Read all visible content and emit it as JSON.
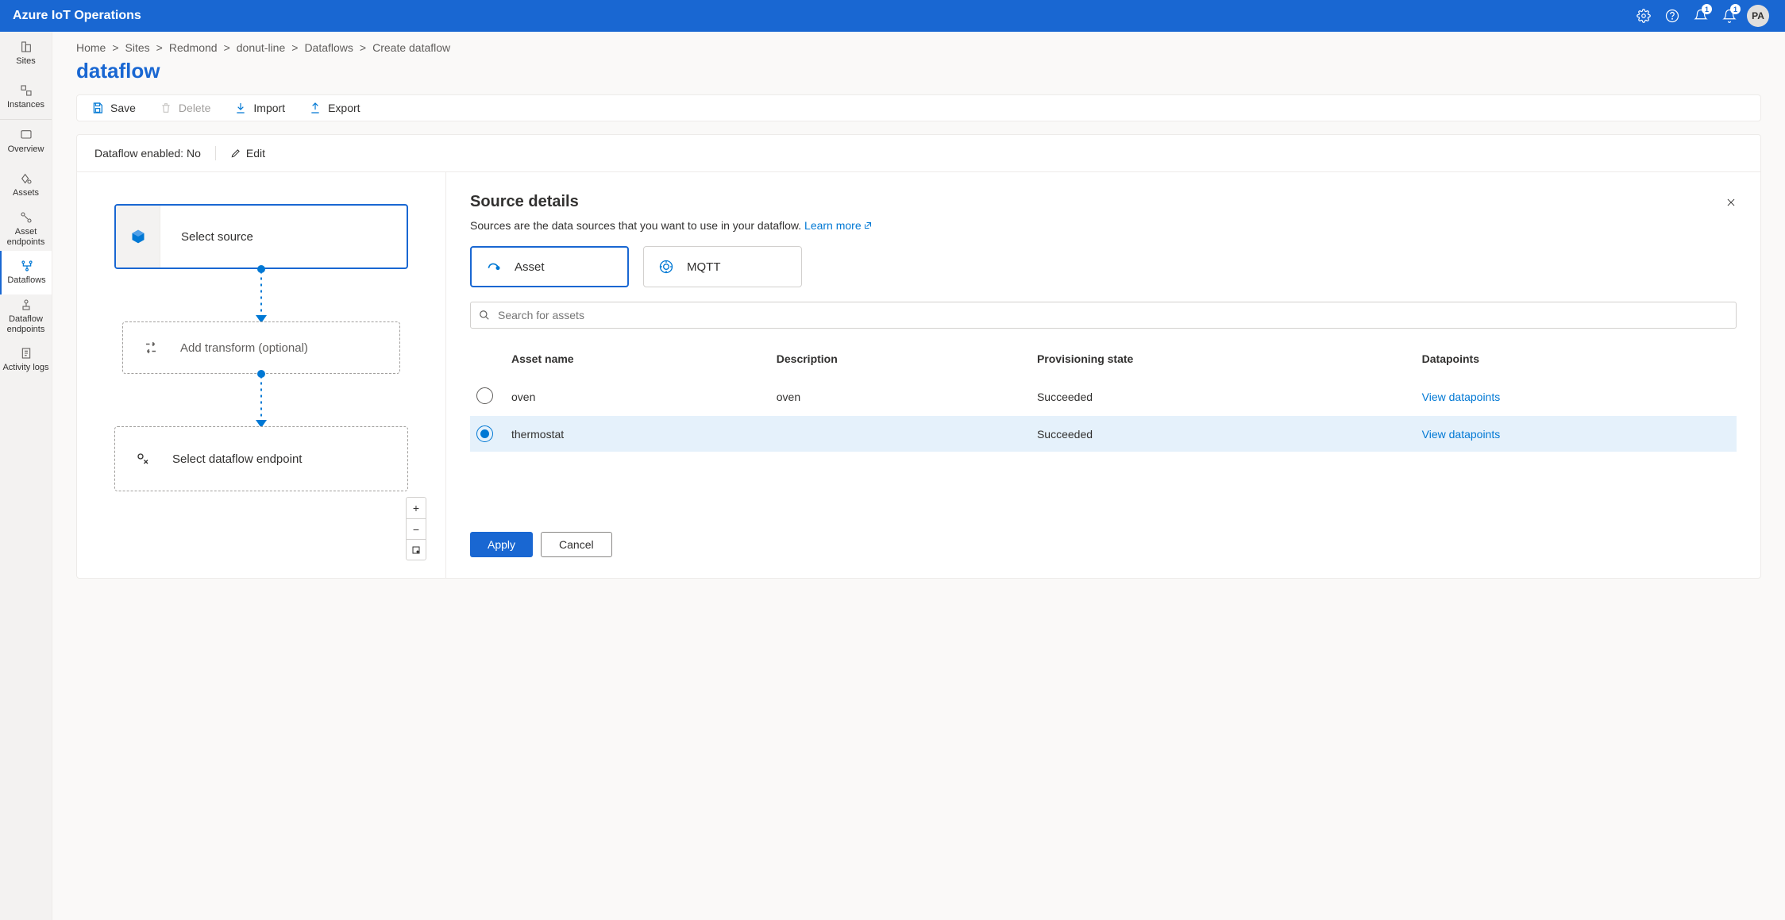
{
  "header": {
    "title": "Azure IoT Operations",
    "notif1_badge": "1",
    "notif2_badge": "1",
    "avatar": "PA"
  },
  "sidebar": {
    "items": [
      {
        "label": "Sites",
        "active": false
      },
      {
        "label": "Instances",
        "active": false
      },
      {
        "label": "Overview",
        "active": false
      },
      {
        "label": "Assets",
        "active": false
      },
      {
        "label": "Asset endpoints",
        "active": false
      },
      {
        "label": "Dataflows",
        "active": true
      },
      {
        "label": "Dataflow endpoints",
        "active": false
      },
      {
        "label": "Activity logs",
        "active": false
      }
    ]
  },
  "breadcrumb": [
    "Home",
    "Sites",
    "Redmond",
    "donut-line",
    "Dataflows",
    "Create dataflow"
  ],
  "page_title": "dataflow",
  "toolbar": {
    "save": "Save",
    "delete": "Delete",
    "import": "Import",
    "export": "Export"
  },
  "status": {
    "enabled_label": "Dataflow enabled: No",
    "edit": "Edit"
  },
  "canvas": {
    "source": "Select source",
    "transform": "Add transform (optional)",
    "endpoint": "Select dataflow endpoint"
  },
  "details": {
    "title": "Source details",
    "desc": "Sources are the data sources that you want to use in your dataflow. ",
    "learn_more": "Learn more",
    "tabs": {
      "asset": "Asset",
      "mqtt": "MQTT"
    },
    "search_placeholder": "Search for assets",
    "columns": {
      "name": "Asset name",
      "desc": "Description",
      "state": "Provisioning state",
      "dp": "Datapoints"
    },
    "rows": [
      {
        "name": "oven",
        "desc": "oven",
        "state": "Succeeded",
        "dp": "View datapoints",
        "selected": false
      },
      {
        "name": "thermostat",
        "desc": "",
        "state": "Succeeded",
        "dp": "View datapoints",
        "selected": true
      }
    ],
    "apply": "Apply",
    "cancel": "Cancel"
  }
}
